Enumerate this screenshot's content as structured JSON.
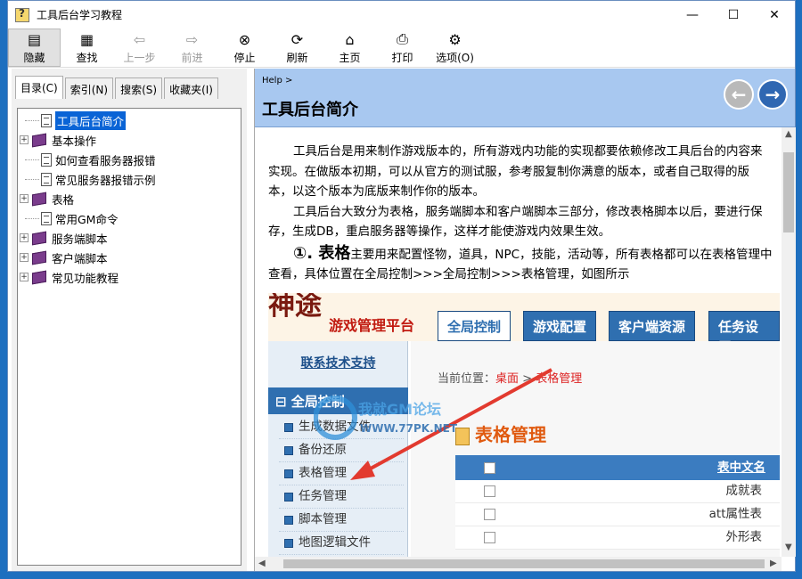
{
  "window": {
    "title": "工具后台学习教程",
    "minimize": "—",
    "maximize": "☐",
    "close": "✕"
  },
  "toolbar": [
    {
      "label": "隐藏",
      "icon": "hide-pane-icon",
      "glyph": "▤",
      "state": "active"
    },
    {
      "label": "查找",
      "icon": "find-icon",
      "glyph": "▦",
      "state": "normal"
    },
    {
      "label": "上一步",
      "icon": "back-arrow-icon",
      "glyph": "⇦",
      "state": "disabled"
    },
    {
      "label": "前进",
      "icon": "forward-arrow-icon",
      "glyph": "⇨",
      "state": "disabled"
    },
    {
      "label": "停止",
      "icon": "stop-icon",
      "glyph": "⊗",
      "state": "normal"
    },
    {
      "label": "刷新",
      "icon": "refresh-icon",
      "glyph": "⟳",
      "state": "normal"
    },
    {
      "label": "主页",
      "icon": "home-icon",
      "glyph": "⌂",
      "state": "normal"
    },
    {
      "label": "打印",
      "icon": "print-icon",
      "glyph": "⎙",
      "state": "normal"
    },
    {
      "label": "选项(O)",
      "icon": "options-icon",
      "glyph": "⚙",
      "state": "normal"
    }
  ],
  "tabs": [
    "目录(C)",
    "索引(N)",
    "搜索(S)",
    "收藏夹(I)"
  ],
  "tree": [
    {
      "label": "工具后台简介",
      "type": "page",
      "selected": true
    },
    {
      "label": "基本操作",
      "type": "book",
      "expander": "+"
    },
    {
      "label": "如何查看服务器报错",
      "type": "page"
    },
    {
      "label": "常见服务器报错示例",
      "type": "page"
    },
    {
      "label": "表格",
      "type": "book",
      "expander": "+"
    },
    {
      "label": "常用GM命令",
      "type": "page"
    },
    {
      "label": "服务端脚本",
      "type": "book",
      "expander": "+"
    },
    {
      "label": "客户端脚本",
      "type": "book",
      "expander": "+"
    },
    {
      "label": "常见功能教程",
      "type": "book",
      "expander": "+"
    }
  ],
  "help": {
    "crumb": "Help >",
    "title": "工具后台简介",
    "back_glyph": "←",
    "forward_glyph": "→"
  },
  "content": {
    "p1": "工具后台是用来制作游戏版本的，所有游戏内功能的实现都要依赖修改工具后台的内容来实现。在做版本初期，可以从官方的测试服，参考服复制你满意的版本，或者自己取得的版本，以这个版本为底版来制作你的版本。",
    "p2": "工具后台大致分为表格，服务端脚本和客户端脚本三部分，修改表格脚本以后，要进行保存，生成DB，重启服务器等操作，这样才能使游戏内效果生效。",
    "section_head": "①. 表格",
    "section_text": "主要用来配置怪物，道具，NPC，技能，活动等，所有表格都可以在表格管理中查看，具体位置在全局控制>>>全局控制>>>表格管理，如图所示"
  },
  "embed": {
    "brand": "神途",
    "brand_sub": "游戏管理平台",
    "tabs": [
      "全局控制",
      "游戏配置",
      "客户端资源",
      "任务设置"
    ],
    "support_link": "联系技术支持",
    "group_head": "⊟ 全局控制",
    "menu": [
      "生成数据文件",
      "备份还原",
      "表格管理",
      "任务管理",
      "脚本管理",
      "地图逻辑文件"
    ],
    "crumb_prefix": "当前位置：",
    "crumb_home": "桌面",
    "crumb_sep": " > ",
    "crumb_page": "表格管理",
    "table_title": "表格管理",
    "table_header": "表中文名",
    "rows": [
      "成就表",
      "att属性表",
      "外形表"
    ],
    "watermark_line1": "我就GM论坛",
    "watermark_line2": "WWW.77PK.NET"
  },
  "colors": {
    "header_bg": "#a8c8f0",
    "selection": "#0a64d6",
    "embed_blue": "#2f6fb0",
    "arrow_red": "#e23a2f"
  }
}
